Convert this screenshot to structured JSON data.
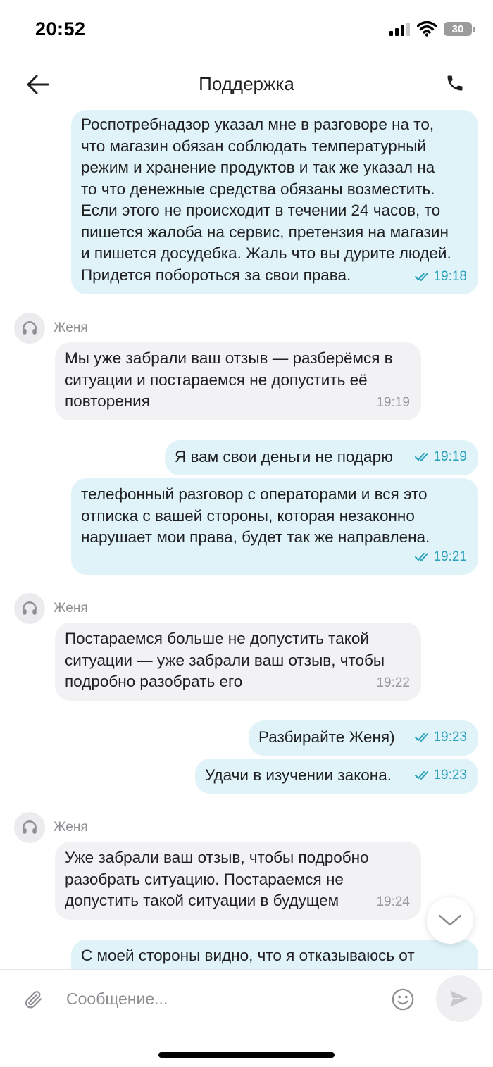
{
  "status_bar": {
    "time": "20:52",
    "battery": "30"
  },
  "header": {
    "title": "Поддержка"
  },
  "messages": [
    {
      "text": "Роспотребнадзор указал мне в разговоре на то,\nчто магазин обязан соблюдать температурный\nрежим и хранение продуктов и так же указал на\nто что денежные средства обязаны возместить.\nЕсли этого не происходит в течении 24 часов, то\nпишется жалоба на сервис, претензия на магазин\nи пишется досудебка. Жаль что вы дурите людей.\nПридется побороться за свои права.",
      "time": "19:18"
    },
    {
      "sender": "Женя",
      "text": "Мы уже забрали ваш отзыв — разберёмся в\nситуации и постараемся не допустить её\nповторения",
      "time": "19:19"
    },
    {
      "text": "Я вам свои деньги не подарю",
      "time": "19:19"
    },
    {
      "text": "телефонный разговор с операторами и вся это\nотписка с вашей стороны, которая незаконно\nнарушает мои права, будет так же направлена.",
      "time": "19:21"
    },
    {
      "sender": "Женя",
      "text": "Постараемся больше не допустить такой\nситуации — уже забрали ваш отзыв, чтобы\nподробно разобрать его",
      "time": "19:22"
    },
    {
      "text": "Разбирайте Женя)",
      "time": "19:23"
    },
    {
      "text": "Удачи в изучении закона.",
      "time": "19:23"
    },
    {
      "sender": "Женя",
      "text": "Уже забрали ваш отзыв, чтобы подробно\nразобрать ситуацию. Постараемся не\nдопустить такой ситуации в будущем",
      "time": "19:24"
    },
    {
      "text": "С моей стороны видно, что я отказываюсь от"
    }
  ],
  "composer": {
    "placeholder": "Сообщение..."
  },
  "colors": {
    "outgoing_bubble": "#dff3f8",
    "incoming_bubble": "#f2f2f4",
    "accent": "#2aa0bb",
    "muted": "#9a9a9e"
  },
  "icons": [
    "back-arrow-icon",
    "phone-icon",
    "headset-icon",
    "double-check-icon",
    "chevron-down-icon",
    "paperclip-icon",
    "smile-icon",
    "send-icon"
  ]
}
